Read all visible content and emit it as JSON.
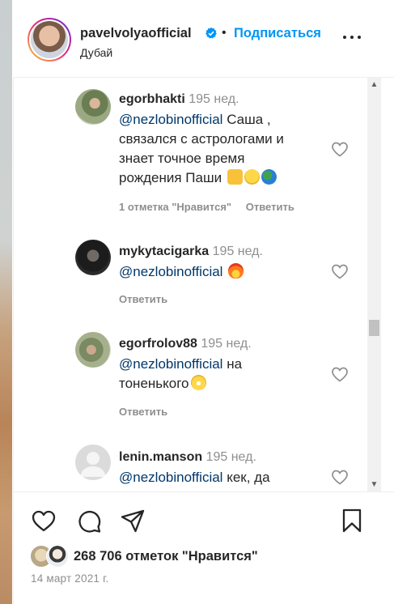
{
  "header": {
    "username": "pavelvolyaofficial",
    "verified": true,
    "separator": "•",
    "follow_label": "Подписаться",
    "location": "Дубай",
    "more_icon": "more-horizontal-icon"
  },
  "comments": [
    {
      "username": "egorbhakti",
      "time": "195 нед.",
      "mention": "@nezlobinofficial",
      "lines": [
        " Саша ,",
        "связался с астрологами и",
        "знает точное время",
        "рождения Паши"
      ],
      "emojis": [
        "raising-hands-emoji",
        "slightly-smiling-emoji",
        "globe-emoji"
      ],
      "likes_label": "1 отметка \"Нравится\"",
      "reply_label": "Ответить"
    },
    {
      "username": "mykytacigarka",
      "time": "195 нед.",
      "mention": "@nezlobinofficial",
      "lines": [
        " "
      ],
      "emojis": [
        "fire-emoji"
      ],
      "reply_label": "Ответить"
    },
    {
      "username": "egorfrolov88",
      "time": "195 нед.",
      "mention": "@nezlobinofficial",
      "lines": [
        " на",
        "тоненького"
      ],
      "emojis": [
        "grinning-sweat-emoji"
      ],
      "reply_label": "Ответить"
    },
    {
      "username": "lenin.manson",
      "time": "195 нед.",
      "mention": "@nezlobinofficial",
      "lines": [
        " кек, да"
      ]
    }
  ],
  "actions": {
    "like_icon": "heart-icon",
    "comment_icon": "comment-icon",
    "share_icon": "send-icon",
    "save_icon": "bookmark-icon"
  },
  "likes_summary": "268 706 отметок \"Нравится\"",
  "date": "14 март 2021 г.",
  "colors": {
    "accent": "#0095f6",
    "mention": "#00376b",
    "secondary_text": "#8e8e8e",
    "primary_text": "#262626"
  }
}
